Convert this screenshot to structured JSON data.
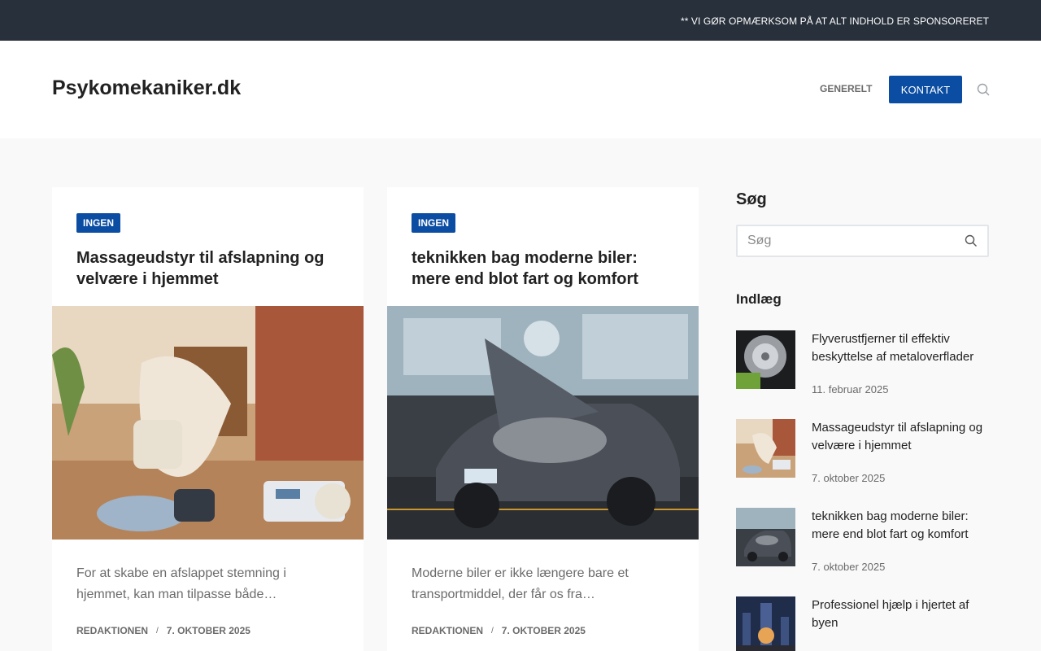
{
  "topbar": {
    "notice": "** VI GØR OPMÆRKSOM PÅ AT ALT INDHOLD ER SPONSORERET"
  },
  "header": {
    "site_title": "Psykomekaniker.dk",
    "nav": {
      "generelt": "GENERELT",
      "kontakt": "KONTAKT"
    },
    "search_icon": "search-icon"
  },
  "cards": [
    {
      "badge": "INGEN",
      "title": "Massageudstyr til afslapning og velvære i hjemmet",
      "excerpt": "For at skabe en afslappet stemning i hjemmet, kan man tilpasse både…",
      "author": "REDAKTIONEN",
      "separator": "/",
      "date": "7. OKTOBER 2025"
    },
    {
      "badge": "INGEN",
      "title": "teknikken bag moderne biler: mere end blot fart og komfort",
      "excerpt": "Moderne biler er ikke længere bare et transportmiddel, der får os fra…",
      "author": "REDAKTIONEN",
      "separator": "/",
      "date": "7. OKTOBER 2025"
    }
  ],
  "sidebar": {
    "search_heading": "Søg",
    "search_placeholder": "Søg",
    "posts_heading": "Indlæg",
    "posts": [
      {
        "title": "Flyverustfjerner til effektiv beskyttelse af metaloverflader",
        "date": "11. februar 2025"
      },
      {
        "title": "Massageudstyr til afslapning og velvære i hjemmet",
        "date": "7. oktober 2025"
      },
      {
        "title": "teknikken bag moderne biler: mere end blot fart og komfort",
        "date": "7. oktober 2025"
      },
      {
        "title": "Professionel hjælp i hjertet af byen",
        "date": ""
      }
    ]
  },
  "colors": {
    "accent": "#0b4da2",
    "topbar": "#28303b",
    "background": "#f9f9f9"
  }
}
